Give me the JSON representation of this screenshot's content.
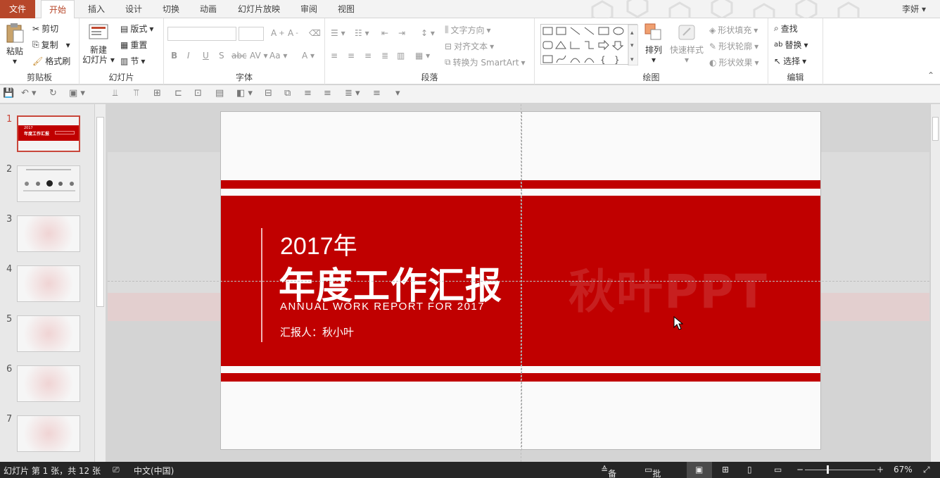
{
  "tabs": {
    "file": "文件",
    "items": [
      "开始",
      "插入",
      "设计",
      "切换",
      "动画",
      "幻灯片放映",
      "审阅",
      "视图"
    ],
    "active": "开始",
    "user": "李妍"
  },
  "ribbon": {
    "clipboard": {
      "label": "剪贴板",
      "paste": "粘贴",
      "cut": "剪切",
      "copy": "复制",
      "format_painter": "格式刷"
    },
    "slides": {
      "label": "幻灯片",
      "new_slide_line1": "新建",
      "new_slide_line2": "幻灯片",
      "layout": "版式",
      "reset": "重置",
      "section": "节"
    },
    "font": {
      "label": "字体"
    },
    "paragraph": {
      "label": "段落",
      "text_direction": "文字方向",
      "align_text": "对齐文本",
      "convert_smartart": "转换为 SmartArt"
    },
    "drawing": {
      "label": "绘图",
      "arrange": "排列",
      "quick_styles": "快速样式",
      "shape_fill": "形状填充",
      "shape_outline": "形状轮廓",
      "shape_effects": "形状效果"
    },
    "editing": {
      "label": "编辑",
      "find": "查找",
      "replace": "替换",
      "select": "选择"
    }
  },
  "thumbnails": {
    "numbers": [
      "1",
      "2",
      "3",
      "4",
      "5",
      "6",
      "7"
    ],
    "selected": "1",
    "thumb1_year": "2017",
    "thumb1_title": "年度工作汇报"
  },
  "slide": {
    "year": "2017年",
    "title": "年度工作汇报",
    "subtitle": "ANNUAL WORK REPORT FOR 2017",
    "reporter": "汇报人：秋小叶",
    "watermark": "秋叶PPT"
  },
  "status": {
    "slide_info": "幻灯片 第 1 张，共 12 张",
    "language": "中文(中国)",
    "notes": "备注",
    "comments": "批注",
    "zoom": "67%"
  },
  "colors": {
    "accent": "#b7472a",
    "slide_red": "#c00000",
    "status_bar": "#262626"
  }
}
